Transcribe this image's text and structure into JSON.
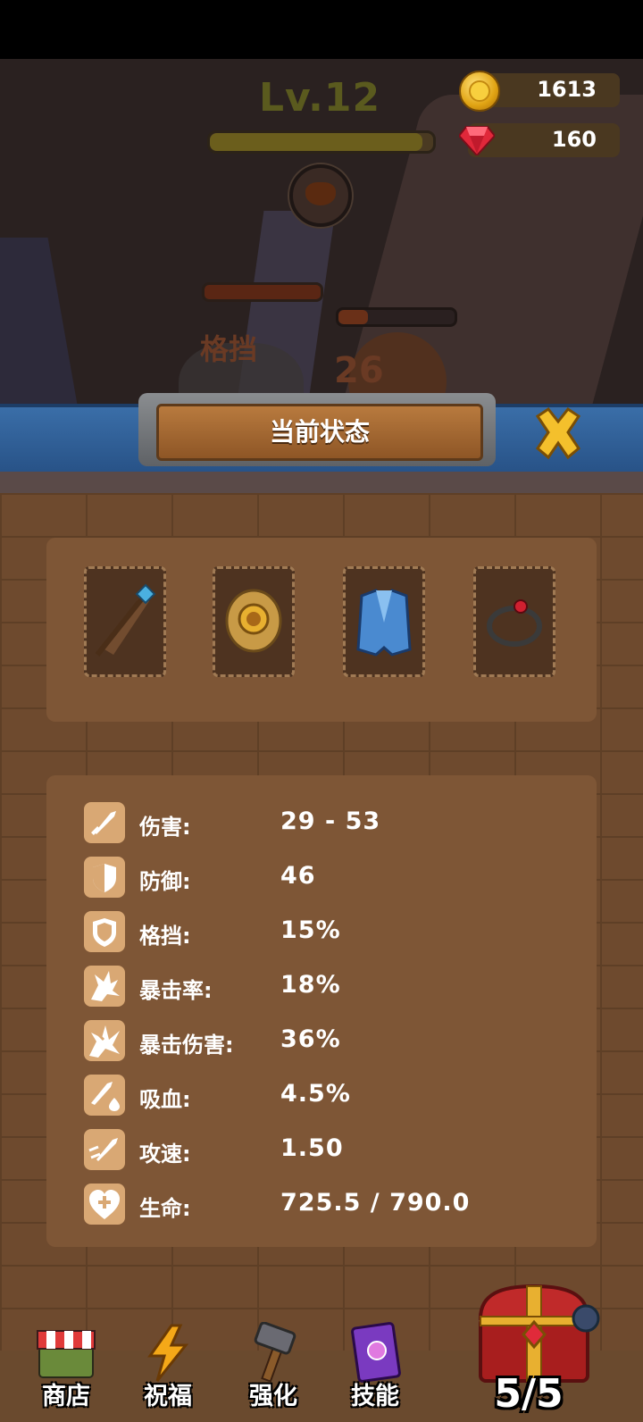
{
  "header": {
    "level": "Lv.12",
    "xp_fraction": 0.95,
    "gold": "1613",
    "gems": "160"
  },
  "battle": {
    "block_popup": "格挡",
    "damage_popup": "26",
    "enemy_hp_fraction": 0.25
  },
  "dialog": {
    "title": "当前状态"
  },
  "equipment": [
    {
      "name": "weapon",
      "icon": "staff-icon"
    },
    {
      "name": "shield",
      "icon": "shield-icon"
    },
    {
      "name": "armor",
      "icon": "armor-icon"
    },
    {
      "name": "ring",
      "icon": "ring-icon"
    }
  ],
  "stats": [
    {
      "label": "伤害:",
      "value": "29 - 53",
      "icon": "sword-icon"
    },
    {
      "label": "防御:",
      "value": "46",
      "icon": "defense-shield-icon"
    },
    {
      "label": "格挡:",
      "value": "15%",
      "icon": "block-shield-icon"
    },
    {
      "label": "暴击率:",
      "value": "18%",
      "icon": "crit-rate-icon"
    },
    {
      "label": "暴击伤害:",
      "value": "36%",
      "icon": "crit-damage-icon"
    },
    {
      "label": "吸血:",
      "value": "4.5%",
      "icon": "lifesteal-icon"
    },
    {
      "label": "攻速:",
      "value": "1.50",
      "icon": "attack-speed-icon"
    },
    {
      "label": "生命:",
      "value": "725.5 / 790.0",
      "icon": "heart-icon"
    }
  ],
  "nav": {
    "shop": "商店",
    "blessing": "祝福",
    "upgrade": "强化",
    "skills": "技能",
    "chest_count": "5/5"
  },
  "colors": {
    "panel": "#6e4a2e",
    "box": "#7e5636",
    "ribbon": "#3a6ea8",
    "icon_bg": "#d9a874"
  }
}
